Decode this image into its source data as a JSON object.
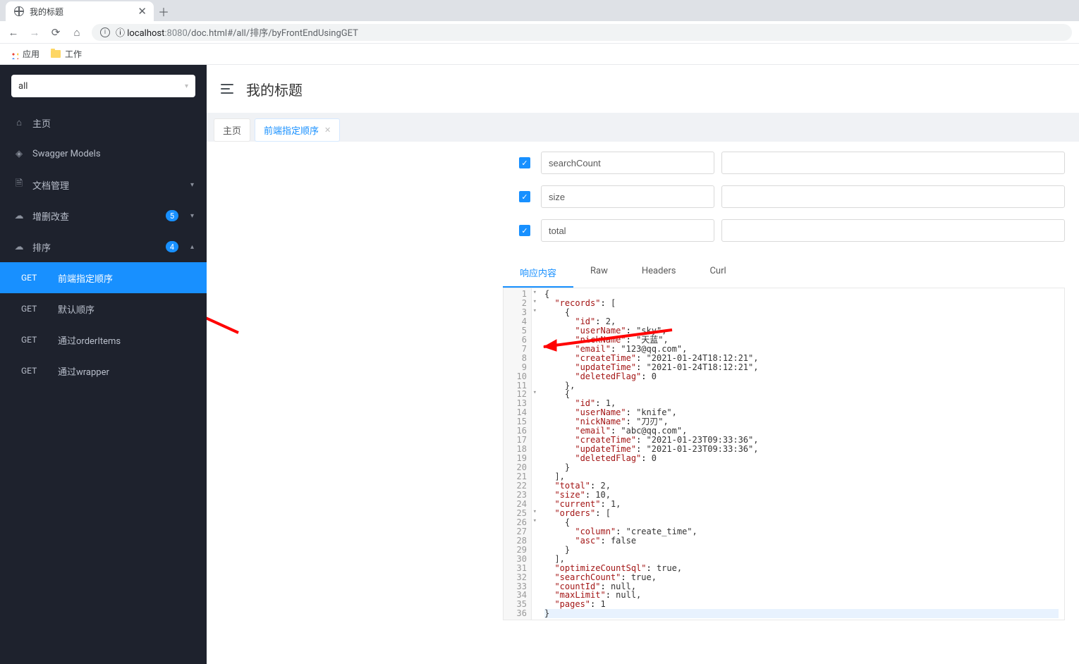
{
  "browser": {
    "tab_title": "我的标题",
    "url_scheme": "ⓘ  localhost",
    "url_port": ":8080",
    "url_path": "/doc.html#/all/排序/byFrontEndUsingGET",
    "bm_apps": "应用",
    "bm_work": "工作"
  },
  "sidebar": {
    "search": "all",
    "items": [
      {
        "icon": "home",
        "label": "主页"
      },
      {
        "icon": "model",
        "label": "Swagger Models"
      },
      {
        "icon": "doc",
        "label": "文档管理",
        "expand": "down"
      },
      {
        "icon": "cloud",
        "label": "增删改查",
        "badge": "5",
        "expand": "down"
      },
      {
        "icon": "cloud",
        "label": "排序",
        "badge": "4",
        "expand": "up"
      }
    ],
    "sort_items": [
      {
        "method": "GET",
        "label": "前端指定顺序",
        "active": true
      },
      {
        "method": "GET",
        "label": "默认顺序"
      },
      {
        "method": "GET",
        "label": "通过orderItems"
      },
      {
        "method": "GET",
        "label": "通过wrapper"
      }
    ]
  },
  "header": {
    "title": "我的标题"
  },
  "tabs": {
    "home": "主页",
    "active": "前端指定顺序"
  },
  "params": [
    {
      "name": "searchCount",
      "value": ""
    },
    {
      "name": "size",
      "value": ""
    },
    {
      "name": "total",
      "value": ""
    }
  ],
  "resp_tabs": [
    "响应内容",
    "Raw",
    "Headers",
    "Curl"
  ],
  "json_response": {
    "records": [
      {
        "id": 2,
        "userName": "sky",
        "nickName": "天蓝",
        "email": "123@qq.com",
        "createTime": "2021-01-24T18:12:21",
        "updateTime": "2021-01-24T18:12:21",
        "deletedFlag": 0
      },
      {
        "id": 1,
        "userName": "knife",
        "nickName": "刀刃",
        "email": "abc@qq.com",
        "createTime": "2021-01-23T09:33:36",
        "updateTime": "2021-01-23T09:33:36",
        "deletedFlag": 0
      }
    ],
    "total": 2,
    "size": 10,
    "current": 1,
    "orders": [
      {
        "column": "create_time",
        "asc": false
      }
    ],
    "optimizeCountSql": true,
    "searchCount": true,
    "countId": null,
    "maxLimit": null,
    "pages": 1
  },
  "code_lines": [
    "{",
    "  \"records\": [",
    "    {",
    "      \"id\": 2,",
    "      \"userName\": \"sky\",",
    "      \"nickName\": \"天蓝\",",
    "      \"email\": \"123@qq.com\",",
    "      \"createTime\": \"2021-01-24T18:12:21\",",
    "      \"updateTime\": \"2021-01-24T18:12:21\",",
    "      \"deletedFlag\": 0",
    "    },",
    "    {",
    "      \"id\": 1,",
    "      \"userName\": \"knife\",",
    "      \"nickName\": \"刀刃\",",
    "      \"email\": \"abc@qq.com\",",
    "      \"createTime\": \"2021-01-23T09:33:36\",",
    "      \"updateTime\": \"2021-01-23T09:33:36\",",
    "      \"deletedFlag\": 0",
    "    }",
    "  ],",
    "  \"total\": 2,",
    "  \"size\": 10,",
    "  \"current\": 1,",
    "  \"orders\": [",
    "    {",
    "      \"column\": \"create_time\",",
    "      \"asc\": false",
    "    }",
    "  ],",
    "  \"optimizeCountSql\": true,",
    "  \"searchCount\": true,",
    "  \"countId\": null,",
    "  \"maxLimit\": null,",
    "  \"pages\": 1",
    "}"
  ]
}
